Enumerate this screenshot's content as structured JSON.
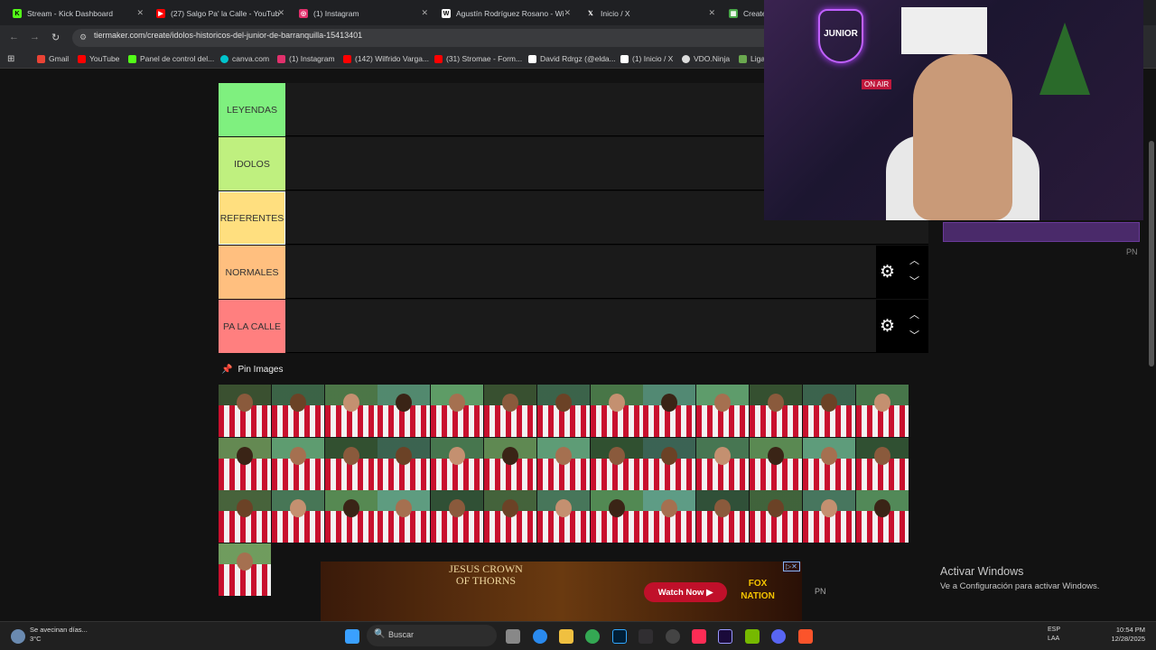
{
  "tabs": [
    {
      "title": "Stream - Kick Dashboard",
      "icon": "kick-icon",
      "color": "#53fc18"
    },
    {
      "title": "(27) Salgo Pa' la Calle - YouTub",
      "icon": "youtube-icon",
      "color": "#ff0000"
    },
    {
      "title": "(1) Instagram",
      "icon": "instagram-icon",
      "color": "#e1306c"
    },
    {
      "title": "Agustín Rodríguez Rosano - Wi",
      "icon": "wikipedia-icon",
      "color": "#ffffff"
    },
    {
      "title": "Inicio / X",
      "icon": "x-icon",
      "color": "#ffffff"
    },
    {
      "title": "Create",
      "icon": "tiermaker-icon",
      "color": "#4aa84a"
    }
  ],
  "address": {
    "url": "tiermaker.com/create/idolos-historicos-del-junior-de-barranquilla-15413401"
  },
  "bookmarks": [
    {
      "label": "Gmail",
      "icon": "gmail-icon",
      "color": "#ea4335"
    },
    {
      "label": "YouTube",
      "icon": "youtube-icon",
      "color": "#ff0000"
    },
    {
      "label": "Panel de control del...",
      "icon": "kick-icon",
      "color": "#53fc18"
    },
    {
      "label": "canva.com",
      "icon": "canva-icon",
      "color": "#00c4cc"
    },
    {
      "label": "(1) Instagram",
      "icon": "instagram-icon",
      "color": "#e1306c"
    },
    {
      "label": "(142) Wilfrido Varga...",
      "icon": "youtube-icon",
      "color": "#ff0000"
    },
    {
      "label": "(31) Stromae - Form...",
      "icon": "youtube-icon",
      "color": "#ff0000"
    },
    {
      "label": "David Rdrgz (@elda...",
      "icon": "tiktok-icon",
      "color": "#ffffff"
    },
    {
      "label": "(1) Inicio / X",
      "icon": "x-icon",
      "color": "#ffffff"
    },
    {
      "label": "VDO.Ninja",
      "icon": "vdo-icon",
      "color": "#dddddd"
    },
    {
      "label": "Liga",
      "icon": "liga-icon",
      "color": "#6aa84f"
    }
  ],
  "tiers": [
    {
      "label": "LEYENDAS",
      "color": "#7ff07f"
    },
    {
      "label": "IDOLOS",
      "color": "#bff07f"
    },
    {
      "label": "REFERENTES",
      "color": "#ffdf7f"
    },
    {
      "label": "NORMALES",
      "color": "#ffbf7f"
    },
    {
      "label": "PA LA CALLE",
      "color": "#ff7f7f"
    }
  ],
  "pin_images": {
    "label": "Pin Images",
    "count": 40
  },
  "webcam": {
    "logo_text": "JUNIOR",
    "on_air": "ON AIR"
  },
  "overlay_pn": "PN",
  "ad": {
    "title": "JESUS CROWN OF THORNS",
    "watch": "Watch Now",
    "brand": "FOX NATION",
    "pn": "PN"
  },
  "activate": {
    "title": "Activar Windows",
    "subtitle": "Ve a Configuración para activar Windows."
  },
  "taskbar": {
    "weather_title": "Se avecinan días...",
    "weather_temp": "3°C",
    "search_placeholder": "Buscar",
    "lang": "ESP",
    "lang2": "LAA",
    "time": "10:54 PM",
    "date": "12/28/2025"
  }
}
